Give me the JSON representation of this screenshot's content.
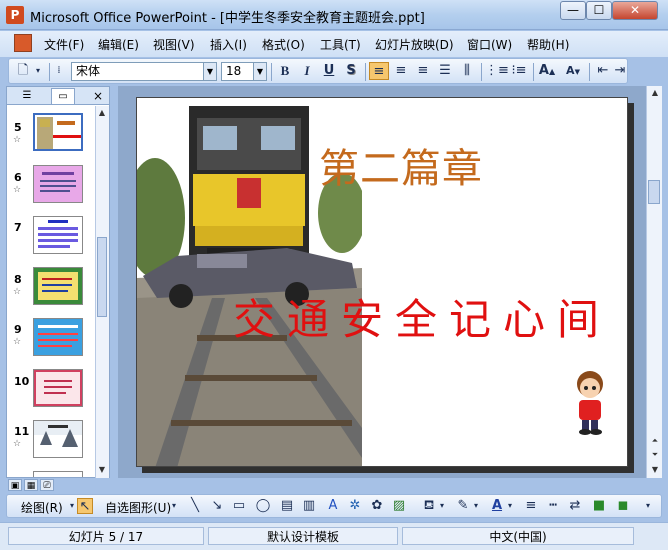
{
  "window": {
    "title": "Microsoft Office PowerPoint - [中学生冬季安全教育主题班会.ppt]",
    "app_icon": "powerpoint-icon",
    "controls": {
      "minimize": "—",
      "maximize": "☐",
      "close": "✕"
    }
  },
  "menu": {
    "items": [
      "文件(F)",
      "编辑(E)",
      "视图(V)",
      "插入(I)",
      "格式(O)",
      "工具(T)",
      "幻灯片放映(D)",
      "窗口(W)",
      "帮助(H)"
    ]
  },
  "toolbar": {
    "font": "宋体",
    "size": "18",
    "bold": "B",
    "italic": "I",
    "underline": "U",
    "shadow": "S",
    "grow_font": "A",
    "shrink_font": "A"
  },
  "panel": {
    "tabs": {
      "outline": "outline-tab-icon",
      "slides": "slides-tab-icon"
    },
    "close": "×",
    "slides": [
      {
        "number": "5",
        "star": "☆"
      },
      {
        "number": "6",
        "star": "☆"
      },
      {
        "number": "7",
        "star": ""
      },
      {
        "number": "8",
        "star": "☆"
      },
      {
        "number": "9",
        "star": "☆"
      },
      {
        "number": "10",
        "star": ""
      },
      {
        "number": "11",
        "star": "☆"
      }
    ]
  },
  "slide": {
    "title": "第二篇章",
    "subtitle": "交通安全记心间"
  },
  "drawing_toolbar": {
    "draw": "绘图(R)",
    "autoshapes": "自选图形(U)"
  },
  "status": {
    "slide_indicator": "幻灯片 5 / 17",
    "design": "默认设计模板",
    "language": "中文(中国)"
  },
  "colors": {
    "title": "#c46a1d",
    "subtitle": "#e01010",
    "chrome": "#a6c1e6",
    "selection": "#3c6cc0"
  }
}
